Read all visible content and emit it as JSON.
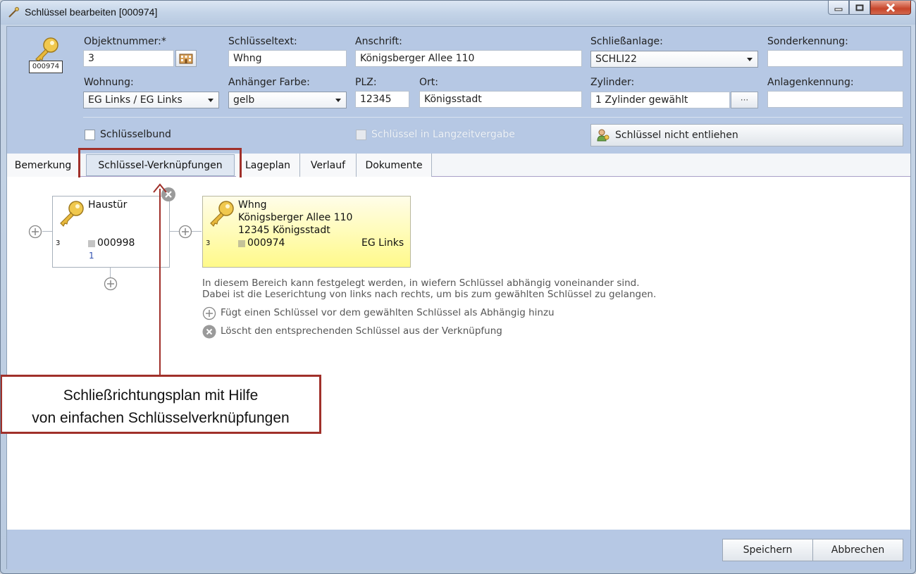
{
  "window": {
    "title": "Schlüssel bearbeiten [000974]"
  },
  "header": {
    "key_badge": "000974",
    "objektnummer": {
      "label": "Objektnummer:*",
      "value": "3"
    },
    "schluesseltext": {
      "label": "Schlüsseltext:",
      "value": "Whng"
    },
    "anschrift": {
      "label": "Anschrift:",
      "value": "Königsberger Allee 110"
    },
    "schliessanlage": {
      "label": "Schließanlage:",
      "value": "SCHLI22"
    },
    "sonderkennung": {
      "label": "Sonderkennung:",
      "value": ""
    },
    "wohnung": {
      "label": "Wohnung:",
      "value": "EG Links / EG Links"
    },
    "anhaenger_farbe": {
      "label": "Anhänger Farbe:",
      "value": "gelb"
    },
    "plz": {
      "label": "PLZ:",
      "value": "12345"
    },
    "ort": {
      "label": "Ort:",
      "value": "Königsstadt"
    },
    "zylinder": {
      "label": "Zylinder:",
      "value": "1 Zylinder gewählt",
      "button": "···"
    },
    "anlagenkennung": {
      "label": "Anlagenkennung:",
      "value": ""
    },
    "schluesselbund": {
      "label": "Schlüsselbund"
    },
    "langzeitvergabe": {
      "label": "Schlüssel in Langzeitvergabe"
    },
    "entleihen_button": "Schlüssel nicht entliehen"
  },
  "tabs": [
    {
      "label": "Bemerkung"
    },
    {
      "label": "Schlüssel-Verknüpfungen"
    },
    {
      "label": "Lageplan"
    },
    {
      "label": "Verlauf"
    },
    {
      "label": "Dokumente"
    }
  ],
  "links": {
    "parent_key": {
      "name": "Haustür",
      "objekt": "3",
      "code": "000998",
      "count": "1"
    },
    "current_key": {
      "name": "Whng",
      "street": "Königsberger Allee 110",
      "city": "12345 Königsstadt",
      "objekt": "3",
      "code": "000974",
      "wohnung": "EG Links"
    },
    "hint_line1": "In diesem Bereich kann festgelegt werden, in wiefern Schlüssel abhängig voneinander sind.",
    "hint_line2": "Dabei ist die Leserichtung von links nach rechts, um bis zum gewählten Schlüssel zu gelangen.",
    "hint_add": "Fügt einen Schlüssel vor dem gewählten Schlüssel als Abhängig hinzu",
    "hint_delete": "Löscht den entsprechenden Schlüssel aus der Verknüpfung"
  },
  "callout": {
    "line1": "Schließrichtungsplan mit Hilfe",
    "line2": "von einfachen Schlüsselverknüpfungen"
  },
  "footer": {
    "save": "Speichern",
    "cancel": "Abbrechen"
  },
  "colors": {
    "form_bg": "#b6c8e4",
    "selected_card": "#fffa8a",
    "highlight": "#a0302a"
  }
}
